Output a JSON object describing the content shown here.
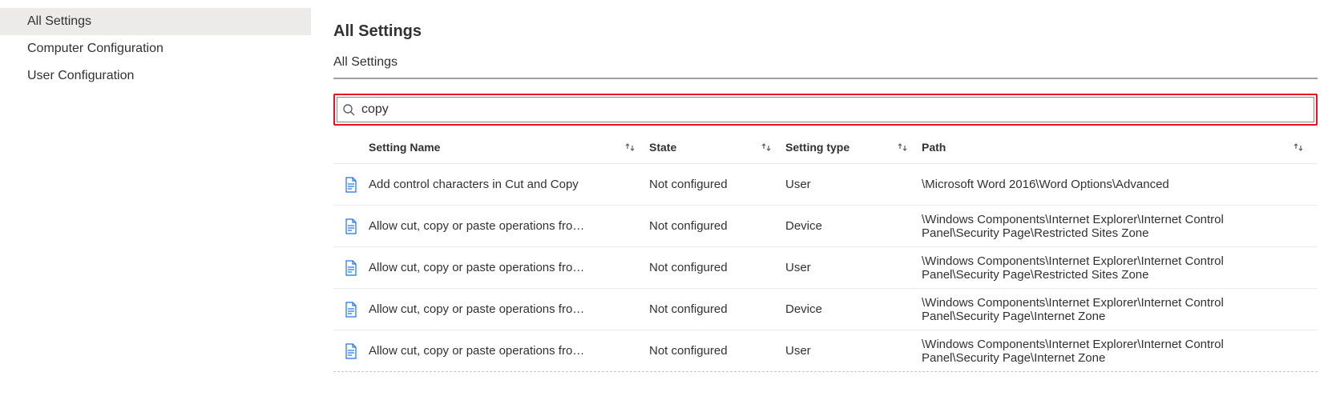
{
  "sidebar": {
    "items": [
      {
        "label": "All Settings",
        "selected": true
      },
      {
        "label": "Computer Configuration",
        "selected": false
      },
      {
        "label": "User Configuration",
        "selected": false
      }
    ]
  },
  "header": {
    "title": "All Settings",
    "breadcrumb": "All Settings"
  },
  "search": {
    "value": "copy"
  },
  "columns": {
    "name": "Setting Name",
    "state": "State",
    "type": "Setting type",
    "path": "Path"
  },
  "rows": [
    {
      "name": "Add control characters in Cut and Copy",
      "state": "Not configured",
      "type": "User",
      "path": "\\Microsoft Word 2016\\Word Options\\Advanced"
    },
    {
      "name": "Allow cut, copy or paste operations fro…",
      "state": "Not configured",
      "type": "Device",
      "path": "\\Windows Components\\Internet Explorer\\Internet Control Panel\\Security Page\\Restricted Sites Zone"
    },
    {
      "name": "Allow cut, copy or paste operations fro…",
      "state": "Not configured",
      "type": "User",
      "path": "\\Windows Components\\Internet Explorer\\Internet Control Panel\\Security Page\\Restricted Sites Zone"
    },
    {
      "name": "Allow cut, copy or paste operations fro…",
      "state": "Not configured",
      "type": "Device",
      "path": "\\Windows Components\\Internet Explorer\\Internet Control Panel\\Security Page\\Internet Zone"
    },
    {
      "name": "Allow cut, copy or paste operations fro…",
      "state": "Not configured",
      "type": "User",
      "path": "\\Windows Components\\Internet Explorer\\Internet Control Panel\\Security Page\\Internet Zone"
    }
  ]
}
